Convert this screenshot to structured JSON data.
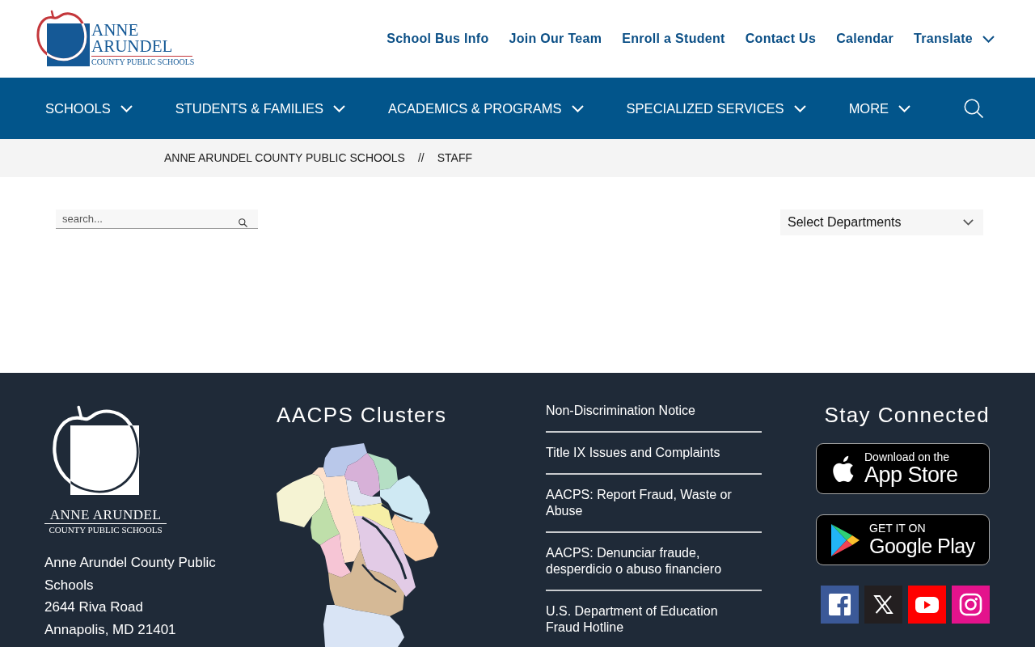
{
  "header": {
    "logo": {
      "lines": [
        "ANNE",
        "ARUNDEL",
        "COUNTY PUBLIC SCHOOLS"
      ]
    },
    "utility_links": [
      {
        "label": "School Bus Info",
        "kind": "link"
      },
      {
        "label": "Join Our Team",
        "kind": "link"
      },
      {
        "label": "Enroll a Student",
        "kind": "link"
      },
      {
        "label": "Contact Us",
        "kind": "link"
      },
      {
        "label": "Calendar",
        "kind": "link"
      },
      {
        "label": "Translate",
        "kind": "dropdown"
      }
    ]
  },
  "main_nav": {
    "items": [
      {
        "label": "SCHOOLS"
      },
      {
        "label": "STUDENTS & FAMILIES"
      },
      {
        "label": "ACADEMICS & PROGRAMS"
      },
      {
        "label": "SPECIALIZED SERVICES"
      },
      {
        "label": "MORE"
      }
    ]
  },
  "breadcrumb": {
    "items": [
      "ANNE ARUNDEL COUNTY PUBLIC SCHOOLS",
      "STAFF"
    ],
    "separator": "//"
  },
  "filters": {
    "search": {
      "placeholder": "search..."
    },
    "department_select": {
      "value": "Select Departments"
    }
  },
  "footer": {
    "logo": {
      "lines": [
        "ANNE ARUNDEL",
        "COUNTY PUBLIC SCHOOLS"
      ]
    },
    "address": [
      "Anne Arundel County Public Schools",
      "2644 Riva Road",
      "Annapolis, MD 21401"
    ],
    "clusters": {
      "title": "AACPS Clusters"
    },
    "links": [
      "Non-Discrimination Notice",
      "Title IX Issues and Complaints",
      "AACPS: Report Fraud, Waste or Abuse",
      "AACPS: Denunciar fraude, desperdicio o abuso financiero",
      "U.S. Department of Education Fraud Hotline"
    ],
    "stay_connected": {
      "title": "Stay Connected",
      "app_badges": [
        {
          "kind": "apple",
          "small_text": "Download on the",
          "large_text": "App Store"
        },
        {
          "kind": "google",
          "small_text": "GET IT ON",
          "large_text": "Google Play"
        }
      ],
      "social": [
        {
          "kind": "facebook"
        },
        {
          "kind": "x"
        },
        {
          "kind": "youtube"
        },
        {
          "kind": "instagram"
        }
      ]
    }
  }
}
